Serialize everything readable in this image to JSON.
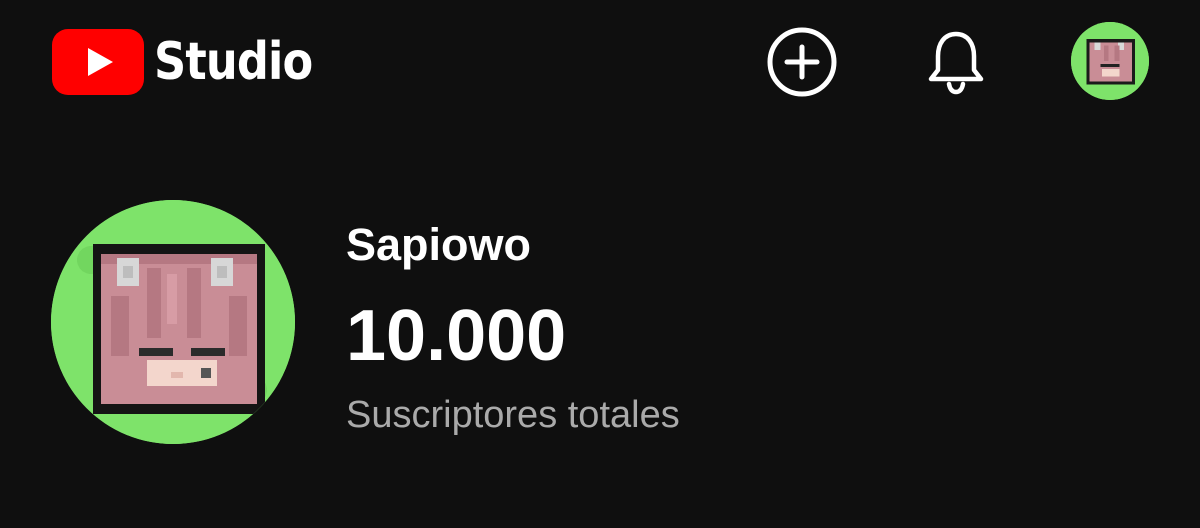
{
  "app": {
    "logo_text": "Studio",
    "brand_color": "#ff0000"
  },
  "topbar": {
    "create_icon": "create-plus-icon",
    "notifications_icon": "bell-icon",
    "account_icon": "avatar"
  },
  "channel": {
    "name": "Sapiowo",
    "subscribers": "10.000",
    "subscribers_label": "Suscriptores totales",
    "avatar_bg": "#7ee36a",
    "avatar_hair": "#c98d96"
  }
}
